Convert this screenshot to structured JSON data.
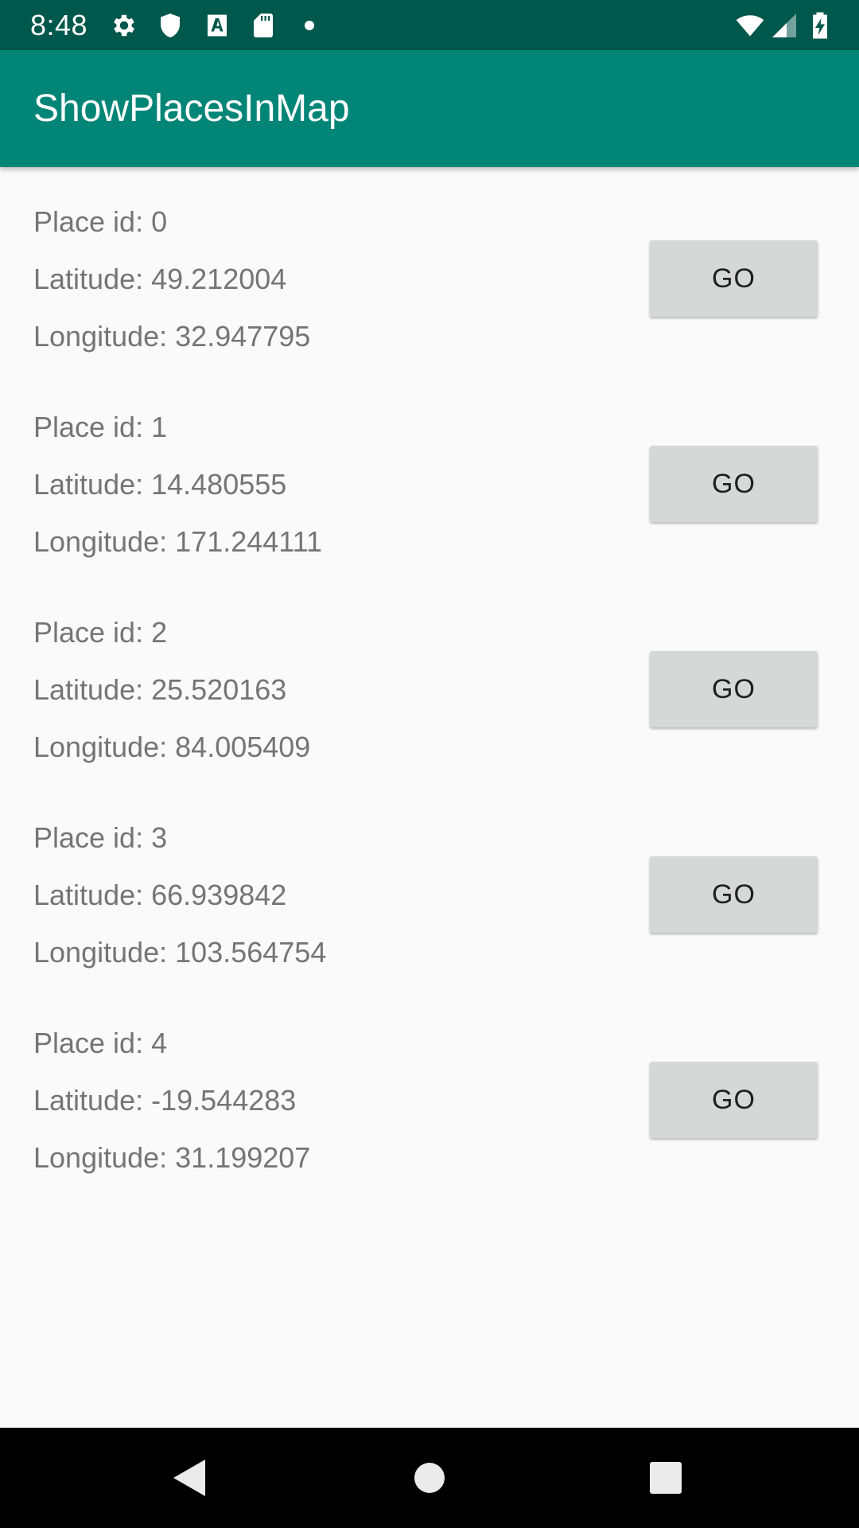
{
  "status_bar": {
    "time": "8:48",
    "icons": [
      "gear-icon",
      "shield-icon",
      "font-a-icon",
      "sd-card-icon",
      "dot-icon",
      "wifi-icon",
      "cell-signal-icon",
      "battery-charging-icon"
    ]
  },
  "app_bar": {
    "title": "ShowPlacesInMap"
  },
  "places": [
    {
      "id_text": "Place id: 0",
      "lat_text": "Latitude: 49.212004",
      "lon_text": "Longitude: 32.947795",
      "button": "GO"
    },
    {
      "id_text": "Place id: 1",
      "lat_text": "Latitude: 14.480555",
      "lon_text": "Longitude: 171.244111",
      "button": "GO"
    },
    {
      "id_text": "Place id: 2",
      "lat_text": "Latitude: 25.520163",
      "lon_text": "Longitude: 84.005409",
      "button": "GO"
    },
    {
      "id_text": "Place id: 3",
      "lat_text": "Latitude: 66.939842",
      "lon_text": "Longitude: 103.564754",
      "button": "GO"
    },
    {
      "id_text": "Place id: 4",
      "lat_text": "Latitude: -19.544283",
      "lon_text": "Longitude: 31.199207",
      "button": "GO"
    }
  ],
  "nav_bar": {
    "icons": [
      "back-icon",
      "home-icon",
      "recents-icon"
    ]
  },
  "colors": {
    "status_bar": "#00574b",
    "app_bar": "#008577",
    "background": "#fafafa",
    "button": "#d6d7d7",
    "secondary_text": "#757575"
  }
}
